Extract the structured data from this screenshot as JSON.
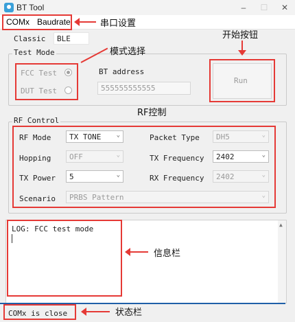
{
  "window": {
    "title": "BT Tool",
    "controls": {
      "minimize": "–",
      "maximize": "☐",
      "close": "✕"
    }
  },
  "menu": {
    "com": "COMx",
    "baudrate": "Baudrate"
  },
  "classic": {
    "label": "Classic",
    "value": "BLE"
  },
  "test_mode": {
    "legend": "Test Mode",
    "fcc": "FCC Test",
    "dut": "DUT Test",
    "selected": "FCC Test"
  },
  "bt_address": {
    "label": "BT address",
    "value": "555555555555"
  },
  "run_button": "Run",
  "rf_control": {
    "legend": "RF Control",
    "rf_mode": {
      "label": "RF Mode",
      "value": "TX TONE"
    },
    "hopping": {
      "label": "Hopping",
      "value": "OFF"
    },
    "tx_power": {
      "label": "TX Power",
      "value": "5"
    },
    "scenario": {
      "label": "Scenario",
      "value": "PRBS Pattern"
    },
    "packet_type": {
      "label": "Packet Type",
      "value": "DH5"
    },
    "tx_frequency": {
      "label": "TX Frequency",
      "value": "2402"
    },
    "rx_frequency": {
      "label": "RX Frequency",
      "value": "2402"
    }
  },
  "log": {
    "text": "LOG: FCC test mode"
  },
  "status": {
    "text": "COMx is close"
  },
  "annotations": {
    "serial_settings": "串口设置",
    "mode_select": "模式选择",
    "start_button": "开始按钮",
    "rf_control": "RF控制",
    "info_bar": "信息栏",
    "status_bar": "状态栏"
  },
  "colors": {
    "annotation_red": "#e53935",
    "status_line_blue": "#1f5fa8"
  }
}
